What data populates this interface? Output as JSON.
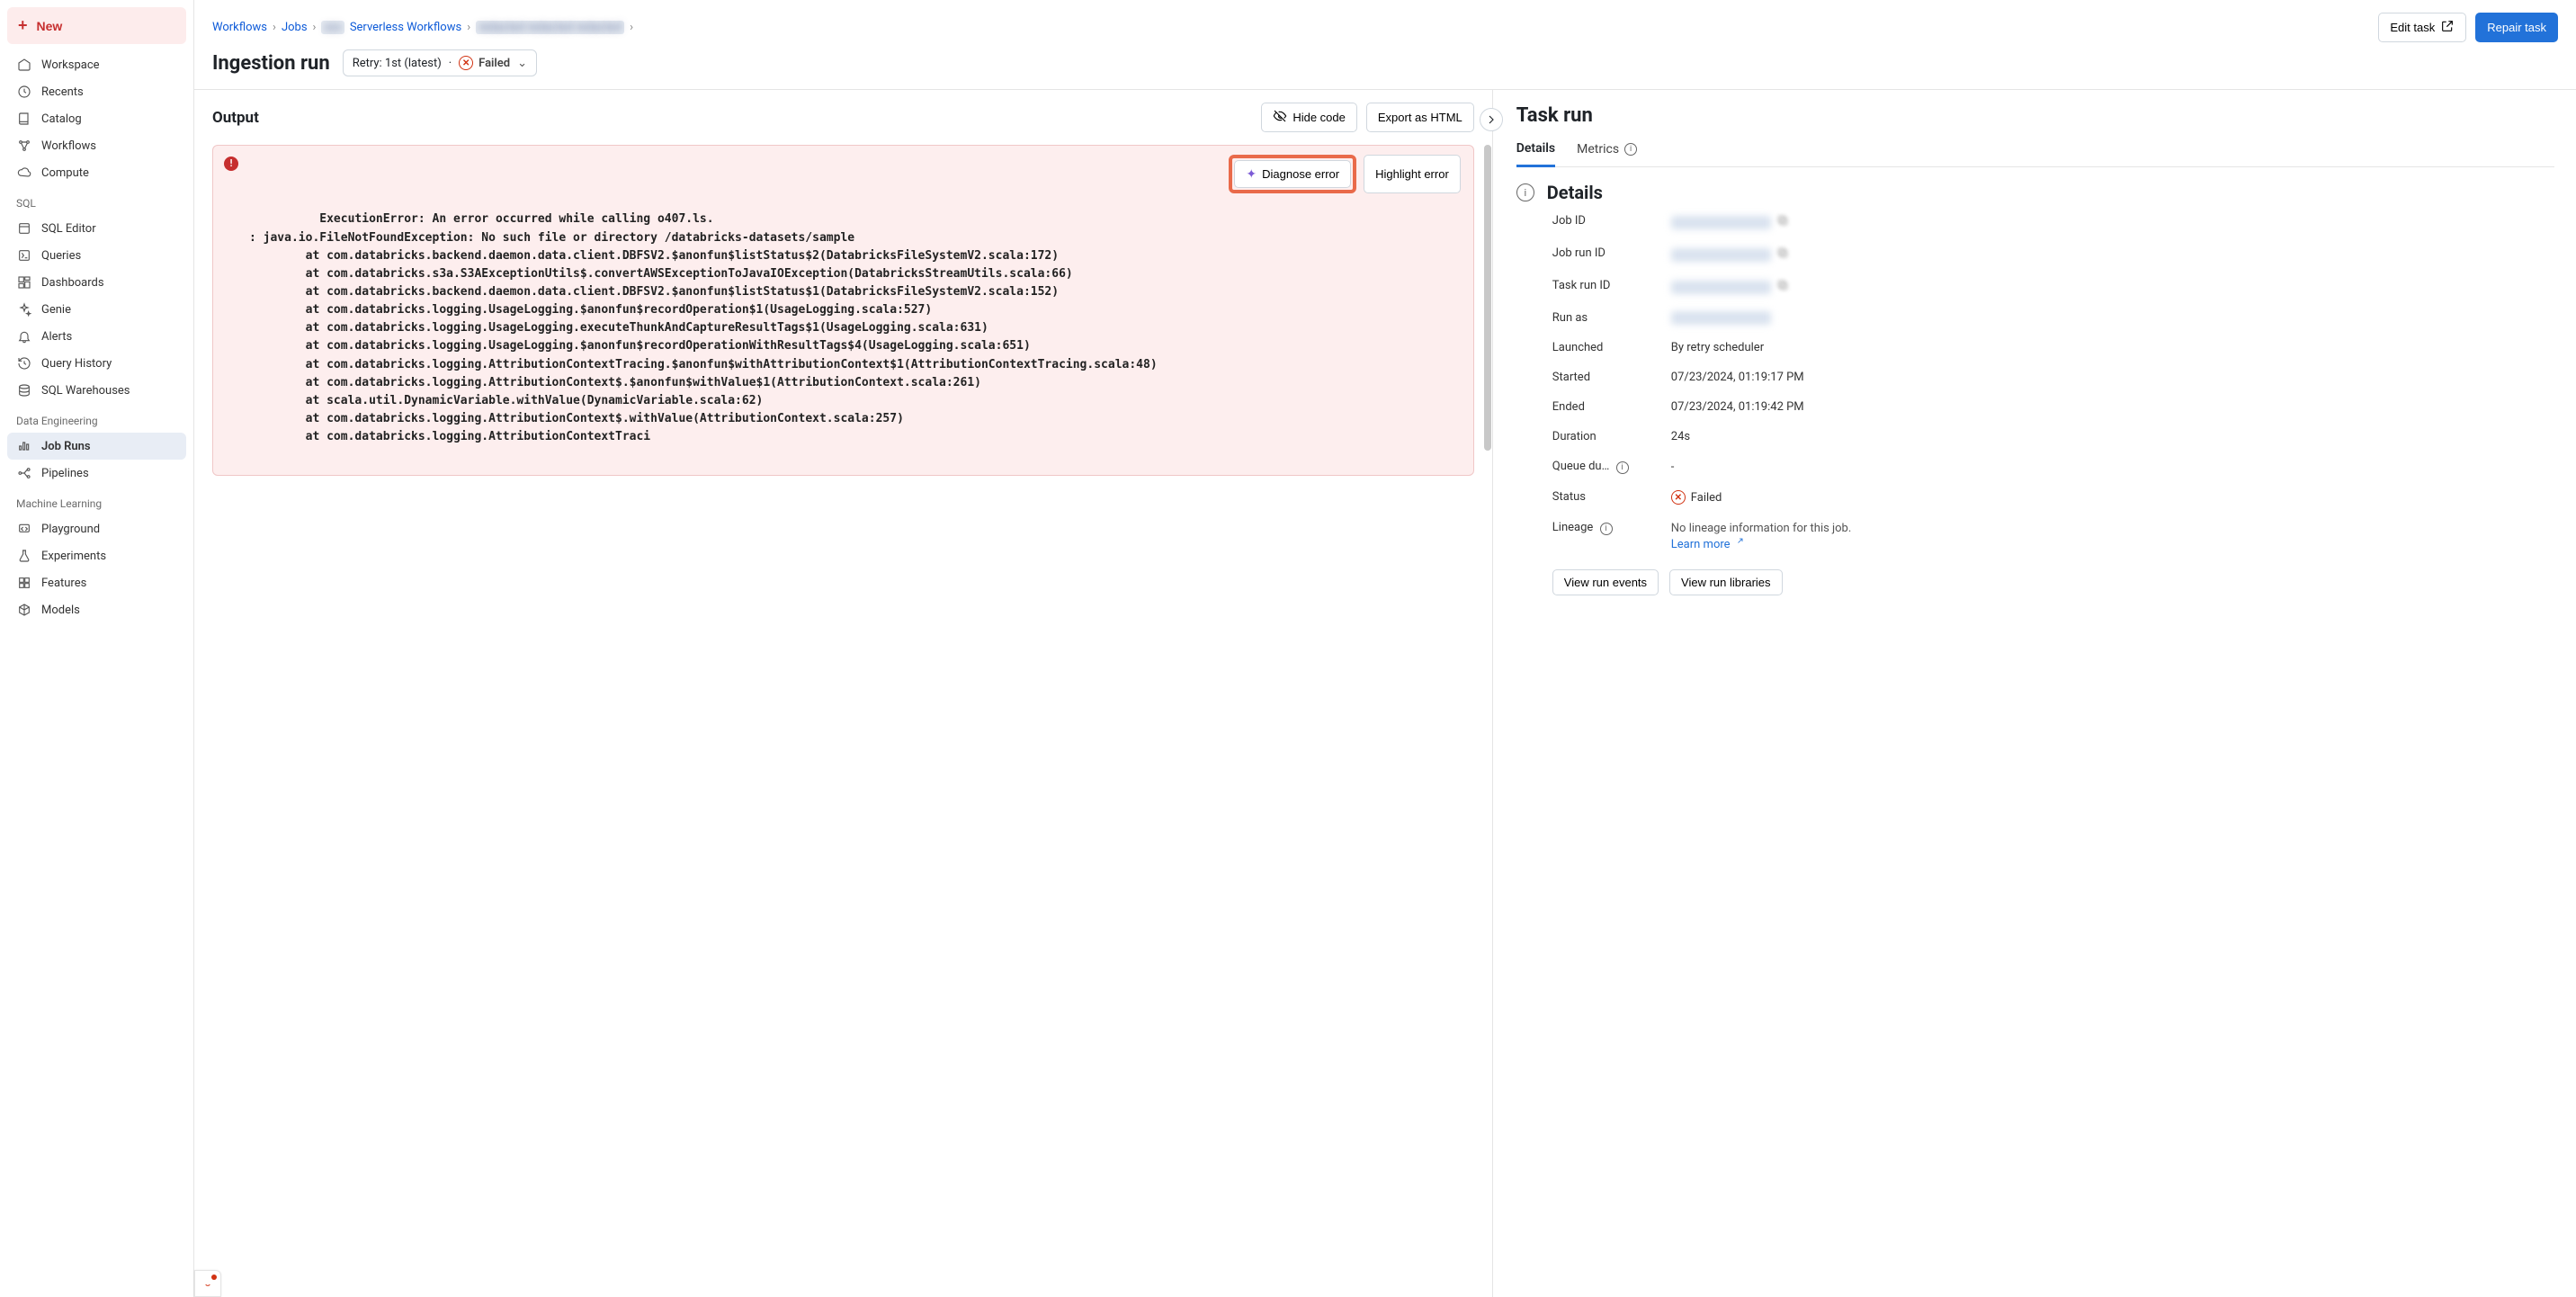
{
  "new_button": "New",
  "sidebar": {
    "main": [
      {
        "label": "Workspace",
        "key": "workspace"
      },
      {
        "label": "Recents",
        "key": "recents"
      },
      {
        "label": "Catalog",
        "key": "catalog"
      },
      {
        "label": "Workflows",
        "key": "workflows"
      },
      {
        "label": "Compute",
        "key": "compute"
      }
    ],
    "sql_header": "SQL",
    "sql": [
      {
        "label": "SQL Editor",
        "key": "sql-editor"
      },
      {
        "label": "Queries",
        "key": "queries"
      },
      {
        "label": "Dashboards",
        "key": "dashboards"
      },
      {
        "label": "Genie",
        "key": "genie"
      },
      {
        "label": "Alerts",
        "key": "alerts"
      },
      {
        "label": "Query History",
        "key": "query-history"
      },
      {
        "label": "SQL Warehouses",
        "key": "sql-warehouses"
      }
    ],
    "de_header": "Data Engineering",
    "de": [
      {
        "label": "Job Runs",
        "key": "job-runs",
        "active": true
      },
      {
        "label": "Pipelines",
        "key": "pipelines"
      }
    ],
    "ml_header": "Machine Learning",
    "ml": [
      {
        "label": "Playground",
        "key": "playground"
      },
      {
        "label": "Experiments",
        "key": "experiments"
      },
      {
        "label": "Features",
        "key": "features"
      },
      {
        "label": "Models",
        "key": "models"
      }
    ]
  },
  "breadcrumb": [
    {
      "label": "Workflows",
      "blur": false
    },
    {
      "label": "Jobs",
      "blur": false
    },
    {
      "label": "Serverless Workflows",
      "blur": false,
      "prefix_blur": true
    },
    {
      "label": "redacted redacted redacted",
      "blur": true
    }
  ],
  "actions": {
    "edit": "Edit task",
    "repair": "Repair task"
  },
  "page_title": "Ingestion run",
  "retry": {
    "label": "Retry: 1st (latest)",
    "sep": "·",
    "status": "Failed"
  },
  "output": {
    "heading": "Output",
    "hide": "Hide code",
    "export": "Export as HTML",
    "diagnose": "Diagnose error",
    "highlight": "Highlight error",
    "error_text": "ExecutionError: An error occurred while calling o407.ls.\n: java.io.FileNotFoundException: No such file or directory /databricks-datasets/sample\n        at com.databricks.backend.daemon.data.client.DBFSV2.$anonfun$listStatus$2(DatabricksFileSystemV2.scala:172)\n        at com.databricks.s3a.S3AExceptionUtils$.convertAWSExceptionToJavaIOException(DatabricksStreamUtils.scala:66)\n        at com.databricks.backend.daemon.data.client.DBFSV2.$anonfun$listStatus$1(DatabricksFileSystemV2.scala:152)\n        at com.databricks.logging.UsageLogging.$anonfun$recordOperation$1(UsageLogging.scala:527)\n        at com.databricks.logging.UsageLogging.executeThunkAndCaptureResultTags$1(UsageLogging.scala:631)\n        at com.databricks.logging.UsageLogging.$anonfun$recordOperationWithResultTags$4(UsageLogging.scala:651)\n        at com.databricks.logging.AttributionContextTracing.$anonfun$withAttributionContext$1(AttributionContextTracing.scala:48)\n        at com.databricks.logging.AttributionContext$.$anonfun$withValue$1(AttributionContext.scala:261)\n        at scala.util.DynamicVariable.withValue(DynamicVariable.scala:62)\n        at com.databricks.logging.AttributionContext$.withValue(AttributionContext.scala:257)\n        at com.databricks.logging.AttributionContextTraci"
  },
  "right": {
    "heading": "Task run",
    "tabs": {
      "details": "Details",
      "metrics": "Metrics"
    },
    "details_heading": "Details",
    "rows": {
      "job_id": {
        "label": "Job ID",
        "blur": true,
        "copy": true
      },
      "job_run_id": {
        "label": "Job run ID",
        "blur": true,
        "copy": true
      },
      "task_run_id": {
        "label": "Task run ID",
        "blur": true,
        "copy": true
      },
      "run_as": {
        "label": "Run as",
        "blur": true,
        "copy": false
      },
      "launched": {
        "label": "Launched",
        "value": "By retry scheduler"
      },
      "started": {
        "label": "Started",
        "value": "07/23/2024, 01:19:17 PM"
      },
      "ended": {
        "label": "Ended",
        "value": "07/23/2024, 01:19:42 PM"
      },
      "duration": {
        "label": "Duration",
        "value": "24s"
      },
      "queue": {
        "label": "Queue du…",
        "value": "-",
        "info": true
      },
      "status": {
        "label": "Status",
        "value": "Failed",
        "failed": true
      },
      "lineage": {
        "label": "Lineage",
        "note": "No lineage information for this job.",
        "learn": "Learn more",
        "info": true
      }
    },
    "buttons": {
      "events": "View run events",
      "libraries": "View run libraries"
    }
  }
}
